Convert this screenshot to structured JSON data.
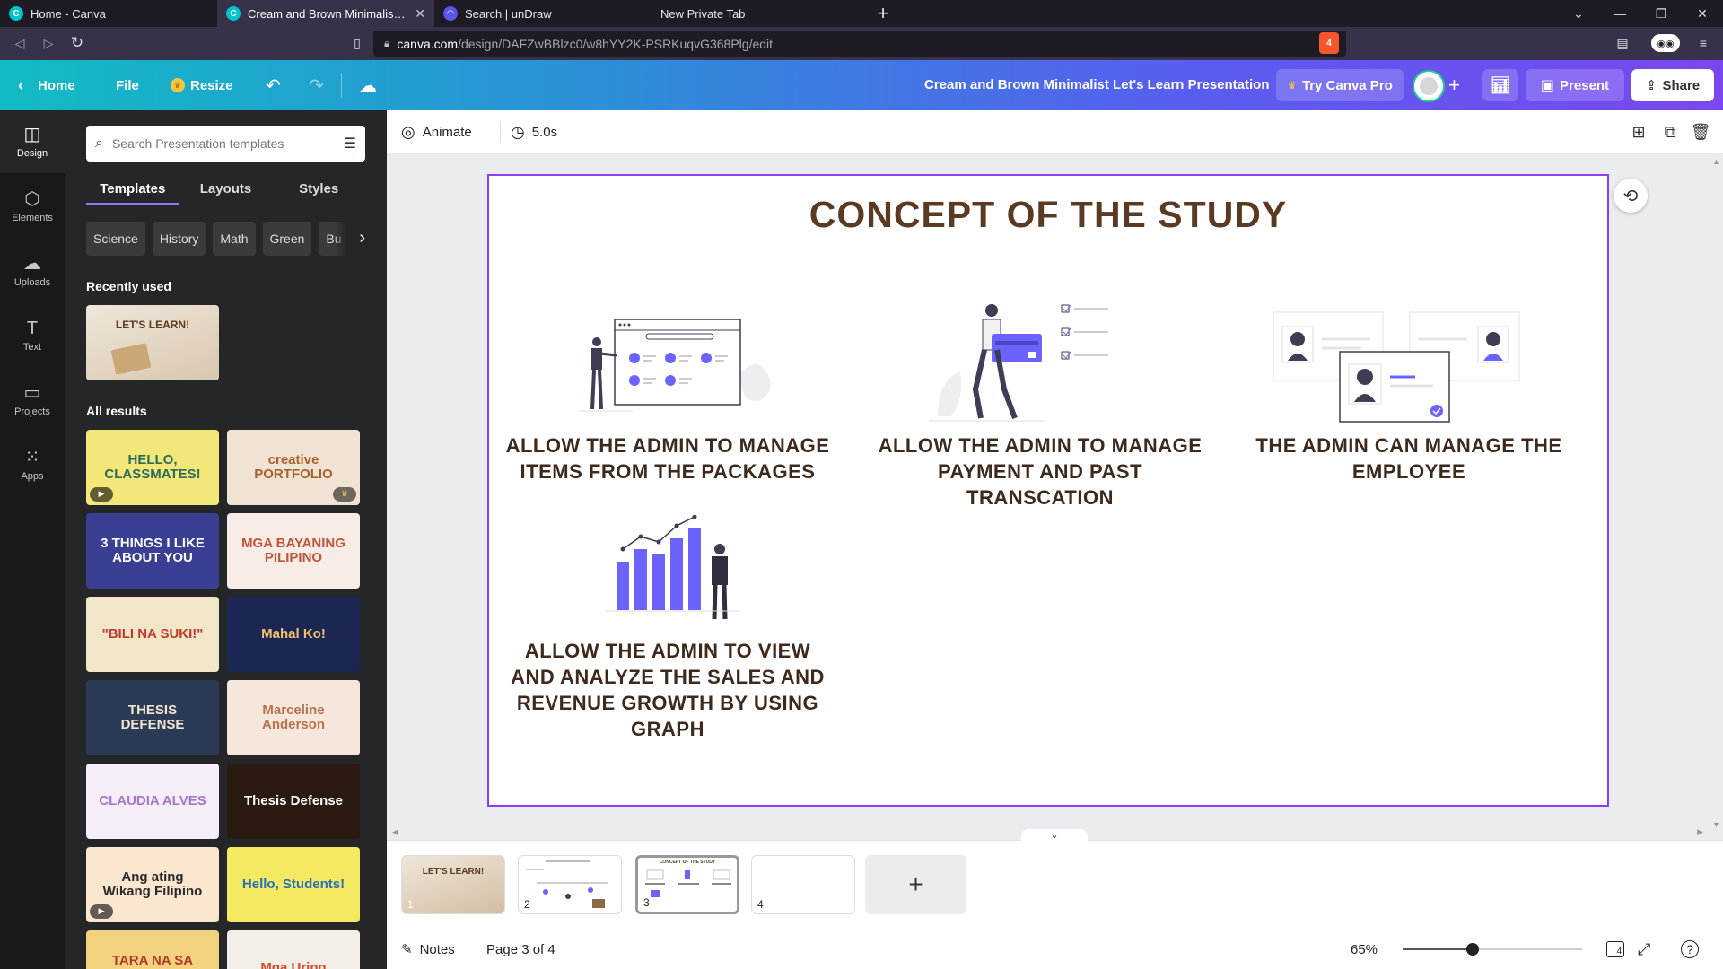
{
  "browser": {
    "tabs": [
      {
        "title": "Home - Canva",
        "active": false
      },
      {
        "title": "Cream and Brown Minimalist Let's Learn Presentation",
        "active": true
      },
      {
        "title": "Search | unDraw",
        "active": false
      },
      {
        "title": "New Private Tab",
        "active": false
      }
    ],
    "url_host": "canva.com",
    "url_path": "/design/DAFZwBBlzc0/w8hYY2K-PSRKuqvG368Plg/edit",
    "shield_badge": "4"
  },
  "header": {
    "home": "Home",
    "file": "File",
    "resize": "Resize",
    "doc_title": "Cream and Brown Minimalist Let's Learn Presentation",
    "try_pro": "Try Canva Pro",
    "present": "Present",
    "share": "Share"
  },
  "rail": [
    {
      "label": "Design",
      "icon": "design-icon"
    },
    {
      "label": "Elements",
      "icon": "elements-icon"
    },
    {
      "label": "Uploads",
      "icon": "uploads-icon"
    },
    {
      "label": "Text",
      "icon": "text-icon"
    },
    {
      "label": "Projects",
      "icon": "folder-icon"
    },
    {
      "label": "Apps",
      "icon": "apps-icon"
    }
  ],
  "panel": {
    "search_placeholder": "Search Presentation templates",
    "tabs": [
      "Templates",
      "Layouts",
      "Styles"
    ],
    "chips": [
      "Science",
      "History",
      "Math",
      "Green",
      "Bu"
    ],
    "recently_used": "Recently used",
    "recent_thumb": "LET'S LEARN!",
    "all_results": "All results",
    "templates": [
      {
        "text": "HELLO, CLASSMATES!",
        "bg": "#f4e77a",
        "fg": "#2d6b5a"
      },
      {
        "text": "creative PORTFOLIO",
        "bg": "#f1e3d3",
        "fg": "#a8622e"
      },
      {
        "text": "3 THINGS I LIKE ABOUT YOU",
        "bg": "#3b3f93",
        "fg": "#ffffff"
      },
      {
        "text": "MGA BAYANING PILIPINO",
        "bg": "#f7ede6",
        "fg": "#c0553a"
      },
      {
        "text": "\"BILI NA SUKI!\"",
        "bg": "#f2e6c8",
        "fg": "#c0392b"
      },
      {
        "text": "Mahal Ko!",
        "bg": "#1c2652",
        "fg": "#f1c26a"
      },
      {
        "text": "THESIS DEFENSE",
        "bg": "#2c3b55",
        "fg": "#f2e6d0"
      },
      {
        "text": "Marceline Anderson",
        "bg": "#f6e7dc",
        "fg": "#b8734b"
      },
      {
        "text": "CLAUDIA ALVES",
        "bg": "#f6eef8",
        "fg": "#a775c9"
      },
      {
        "text": "Thesis Defense",
        "bg": "#2a1a12",
        "fg": "#ffffff"
      },
      {
        "text": "Ang ating Wikang Filipino",
        "bg": "#fbe6cf",
        "fg": "#2a2a2a"
      },
      {
        "text": "Hello, Students!",
        "bg": "#f4ea62",
        "fg": "#2c6fb8"
      },
      {
        "text": "TARA NA SA MAYNILA!",
        "bg": "#f2d27e",
        "fg": "#b33b2a"
      },
      {
        "text": "Mga Uring",
        "bg": "#f3efe8",
        "fg": "#d24b2a"
      }
    ]
  },
  "toolbar": {
    "animate": "Animate",
    "duration": "5.0s"
  },
  "slide": {
    "title": "CONCEPT OF THE STUDY",
    "items": [
      "ALLOW THE ADMIN TO MANAGE ITEMS FROM THE  PACKAGES",
      "ALLOW THE ADMIN TO MANAGE PAYMENT AND PAST TRANSCATION",
      "THE ADMIN CAN MANAGE THE EMPLOYEE",
      "ALLOW THE ADMIN TO VIEW AND ANALYZE THE SALES AND REVENUE GROWTH BY USING GRAPH"
    ]
  },
  "pages": [
    {
      "num": "1",
      "label": "LET'S LEARN!"
    },
    {
      "num": "2",
      "label": ""
    },
    {
      "num": "3",
      "label": "CONCEPT OF THE STUDY"
    },
    {
      "num": "4",
      "label": ""
    }
  ],
  "bottom": {
    "notes": "Notes",
    "page_indicator": "Page 3 of 4",
    "zoom": "65%",
    "zoom_level": 0.39,
    "grid_count": "4"
  },
  "colors": {
    "accent": "#8b3dff",
    "slide_text": "#3e2a1c",
    "illustration": "#6c63ff"
  }
}
